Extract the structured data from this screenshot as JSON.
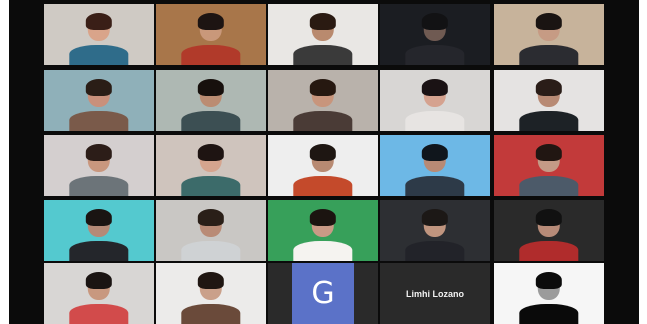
{
  "meeting": {
    "layout": "gallery",
    "accent_active_speaker": "#b7d64a"
  },
  "participants": [
    {
      "id": "p01",
      "kind": "video",
      "bg": "#cfcac4",
      "shirt": "#2f6c8a",
      "skin": "#d9a48a",
      "hair": "#3a1f17"
    },
    {
      "id": "p02",
      "kind": "video",
      "bg": "#a8764a",
      "shirt": "#b13a2a",
      "skin": "#c9987a",
      "hair": "#1d1412"
    },
    {
      "id": "p03",
      "kind": "video",
      "bg": "#e9e7e4",
      "shirt": "#3a3a3a",
      "skin": "#b98a6e",
      "hair": "#2a1a12"
    },
    {
      "id": "p04",
      "kind": "video",
      "bg": "#1b1d22",
      "shirt": "#25262c",
      "skin": "#6f5a52",
      "hair": "#121214"
    },
    {
      "id": "p05",
      "kind": "video",
      "bg": "#c7b39b",
      "shirt": "#2b2c31",
      "skin": "#c69b84",
      "hair": "#1a1412",
      "active": true
    },
    {
      "id": "p06",
      "kind": "video",
      "bg": "#8fb0b9",
      "shirt": "#7a5a4a",
      "skin": "#c9907b",
      "hair": "#2a1d16"
    },
    {
      "id": "p07",
      "kind": "video",
      "bg": "#aeb8b3",
      "shirt": "#3c4f53",
      "skin": "#bb8c72",
      "hair": "#17100d"
    },
    {
      "id": "p08",
      "kind": "video",
      "bg": "#b9b2ab",
      "shirt": "#4a3b36",
      "skin": "#c8957c",
      "hair": "#261810"
    },
    {
      "id": "p09",
      "kind": "video",
      "bg": "#d8d6d4",
      "shirt": "#e7e4e2",
      "skin": "#d5a28f",
      "hair": "#1a1214"
    },
    {
      "id": "p10",
      "kind": "video",
      "bg": "#e5e3e2",
      "shirt": "#1d2226",
      "skin": "#b88a74",
      "hair": "#2a1d18"
    },
    {
      "id": "p11",
      "kind": "video",
      "bg": "#d4cfcf",
      "shirt": "#6c7479",
      "skin": "#c9977e",
      "hair": "#2c1d18"
    },
    {
      "id": "p12",
      "kind": "video",
      "bg": "#cfc4bd",
      "shirt": "#3c6b6a",
      "skin": "#d5a48e",
      "hair": "#1e1412"
    },
    {
      "id": "p13",
      "kind": "video",
      "bg": "#eeeeee",
      "shirt": "#c44a2b",
      "skin": "#b88a72",
      "hair": "#1e1612"
    },
    {
      "id": "p14",
      "kind": "video",
      "bg": "#6db8e6",
      "shirt": "#2d3a48",
      "skin": "#b88a75",
      "hair": "#10161c"
    },
    {
      "id": "p15",
      "kind": "video",
      "bg": "#c23a3a",
      "shirt": "#4c5a69",
      "skin": "#c49a86",
      "hair": "#211612"
    },
    {
      "id": "p16",
      "kind": "video",
      "bg": "#54c9cf",
      "shirt": "#24262b",
      "skin": "#b58a77",
      "hair": "#1a1412"
    },
    {
      "id": "p17",
      "kind": "video",
      "bg": "#c9c7c4",
      "shirt": "#cfd2d4",
      "skin": "#b98b76",
      "hair": "#2a1f18"
    },
    {
      "id": "p18",
      "kind": "video",
      "bg": "#37a05a",
      "shirt": "#f5f3f0",
      "skin": "#c99a86",
      "hair": "#1b1410"
    },
    {
      "id": "p19",
      "kind": "video",
      "bg": "#2d2f33",
      "shirt": "#222329",
      "skin": "#c0957f",
      "hair": "#1c1816"
    },
    {
      "id": "p20",
      "kind": "video",
      "bg": "#2a2a2a",
      "shirt": "#b02c2c",
      "skin": "#b78b78",
      "hair": "#111111"
    },
    {
      "id": "p21",
      "kind": "video",
      "bg": "#d8d6d4",
      "shirt": "#d24b4b",
      "skin": "#c8987f",
      "hair": "#1a1412"
    },
    {
      "id": "p22",
      "kind": "video",
      "bg": "#ecebea",
      "shirt": "#6a4a3a",
      "skin": "#caa08a",
      "hair": "#1f1612"
    },
    {
      "id": "p23",
      "kind": "avatar",
      "avatar_letter": "G",
      "avatar_color": "#5b72c8"
    },
    {
      "id": "p24",
      "kind": "name",
      "display_name": "Limhi Lozano"
    },
    {
      "id": "p25",
      "kind": "video",
      "bg": "#f0f0f0",
      "shirt": "#101010",
      "skin": "#9a9a9a",
      "hair": "#111111",
      "grayscale": true
    }
  ]
}
